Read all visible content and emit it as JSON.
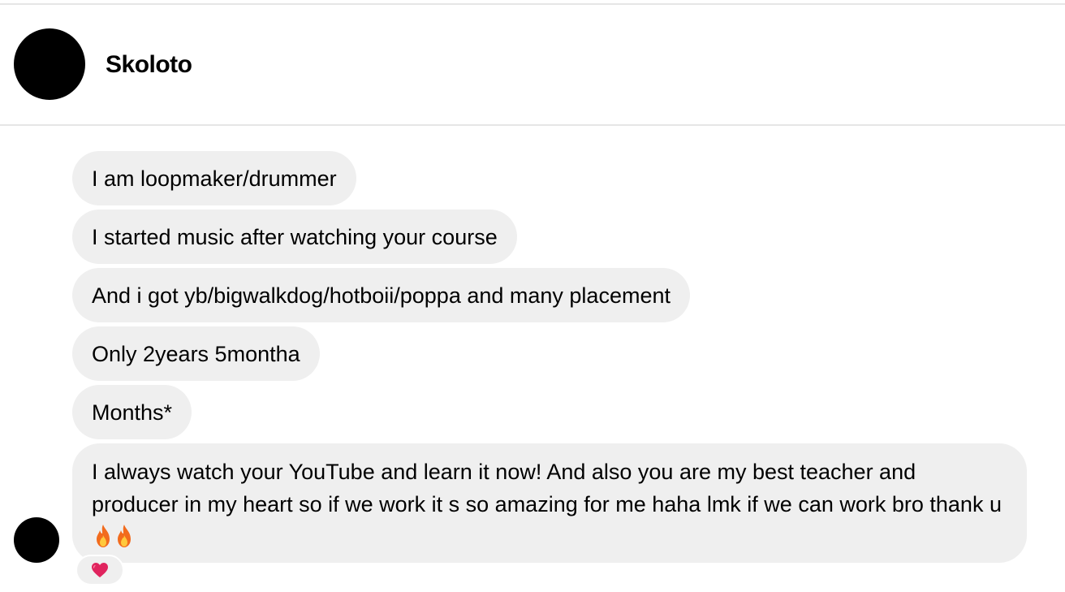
{
  "conversation": {
    "contact_name": "Skoloto"
  },
  "messages": [
    "I am loopmaker/drummer",
    "I started music after watching your course",
    "And i got yb/bigwalkdog/hotboii/poppa and many placement",
    "Only 2years 5montha",
    "Months*",
    "I always watch your YouTube and learn it now! And also you are my best teacher and producer in my heart so if we work it s so amazing for me haha lmk if we can work bro thank u"
  ],
  "last_message_emojis": [
    "fire-emoji",
    "fire-emoji"
  ],
  "reaction": {
    "emoji": "red-heart-emoji"
  },
  "colors": {
    "bubble_background": "#efefef",
    "avatar": "#000000",
    "divider": "#e6e6e6",
    "heart": "#e0245e",
    "fire_outer": "#f26b1d",
    "fire_inner": "#ffc93c"
  }
}
